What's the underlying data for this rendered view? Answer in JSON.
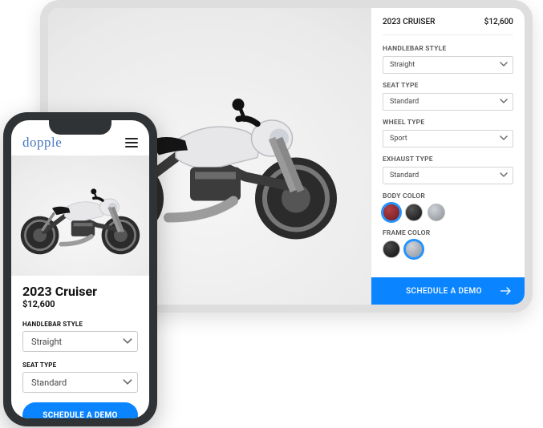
{
  "product": {
    "name_upper": "2023 CRUISER",
    "name_title": "2023 Cruiser",
    "price": "$12,600"
  },
  "panel": {
    "handlebar": {
      "label": "HANDLEBAR STYLE",
      "value": "Straight"
    },
    "seat": {
      "label": "SEAT TYPE",
      "value": "Standard"
    },
    "wheel": {
      "label": "WHEEL TYPE",
      "value": "Sport"
    },
    "exhaust": {
      "label": "EXHAUST TYPE",
      "value": "Standard"
    },
    "body_color": {
      "label": "BODY COLOR",
      "options": [
        "#6e1a1f",
        "#111111",
        "#8a8f94"
      ],
      "selected_index": 0
    },
    "frame_color": {
      "label": "FRAME COLOR",
      "options": [
        "#0f0f0f",
        "#8f959b"
      ],
      "selected_index": 1
    },
    "cta": "SCHEDULE A DEMO"
  },
  "mobile": {
    "brand": "dopple",
    "handlebar": {
      "label": "HANDLEBAR STYLE",
      "value": "Straight"
    },
    "seat": {
      "label": "SEAT TYPE",
      "value": "Standard"
    },
    "cta": "SCHEDULE A DEMO"
  }
}
